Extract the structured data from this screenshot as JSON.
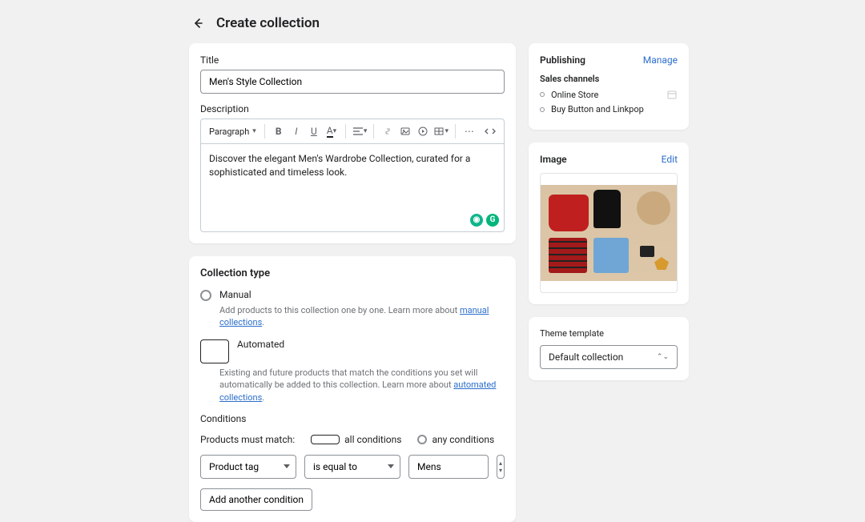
{
  "header": {
    "title": "Create collection"
  },
  "main": {
    "title_label": "Title",
    "title_value": "Men's Style Collection",
    "desc_label": "Description",
    "toolbar": {
      "para": "Paragraph"
    },
    "desc_value": "Discover the elegant Men's Wardrobe Collection, curated for a sophisticated and timeless look."
  },
  "ctype": {
    "heading": "Collection type",
    "manual": {
      "label": "Manual",
      "help_prefix": "Add products to this collection one by one. Learn more about ",
      "help_link": "manual collections",
      "help_suffix": "."
    },
    "auto": {
      "label": "Automated",
      "help_prefix": "Existing and future products that match the conditions you set will automatically be added to this collection. Learn more about ",
      "help_link": "automated collections",
      "help_suffix": "."
    },
    "selected": "auto",
    "conditions_heading": "Conditions",
    "match_label": "Products must match:",
    "all_label": "all conditions",
    "any_label": "any conditions",
    "match_selected": "all",
    "row": {
      "field": "Product tag",
      "op": "is equal to",
      "value": "Mens"
    },
    "add_btn": "Add another condition"
  },
  "publishing": {
    "heading": "Publishing",
    "manage": "Manage",
    "channels_label": "Sales channels",
    "channels": [
      "Online Store",
      "Buy Button and Linkpop"
    ]
  },
  "image": {
    "heading": "Image",
    "edit": "Edit"
  },
  "theme": {
    "heading": "Theme template",
    "value": "Default collection"
  }
}
